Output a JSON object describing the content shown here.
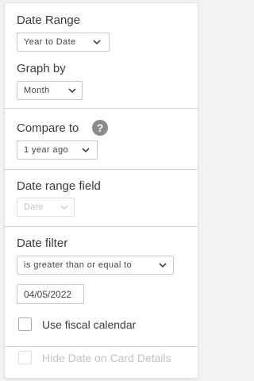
{
  "date_range": {
    "heading": "Date Range",
    "selected": "Year to Date"
  },
  "graph_by": {
    "heading": "Graph by",
    "selected": "Month"
  },
  "compare_to": {
    "heading": "Compare to",
    "help_icon": "?",
    "selected": "1 year ago"
  },
  "date_range_field": {
    "heading": "Date range field",
    "selected": "Date"
  },
  "date_filter": {
    "heading": "Date filter",
    "operator": "is greater than or equal to",
    "value": "04/05/2022"
  },
  "fiscal_calendar": {
    "label": "Use fiscal calendar",
    "checked": false
  },
  "hide_date": {
    "label": "Hide Date on Card Details",
    "checked": false,
    "disabled": true
  },
  "icons": {
    "dropdown": "chevron-down-icon",
    "help": "help-icon"
  },
  "colors": {
    "panel_bg": "#ffffff",
    "page_bg": "#f2f2f2",
    "border": "#c7c7c7",
    "disabled_text": "#c3c3c3"
  }
}
